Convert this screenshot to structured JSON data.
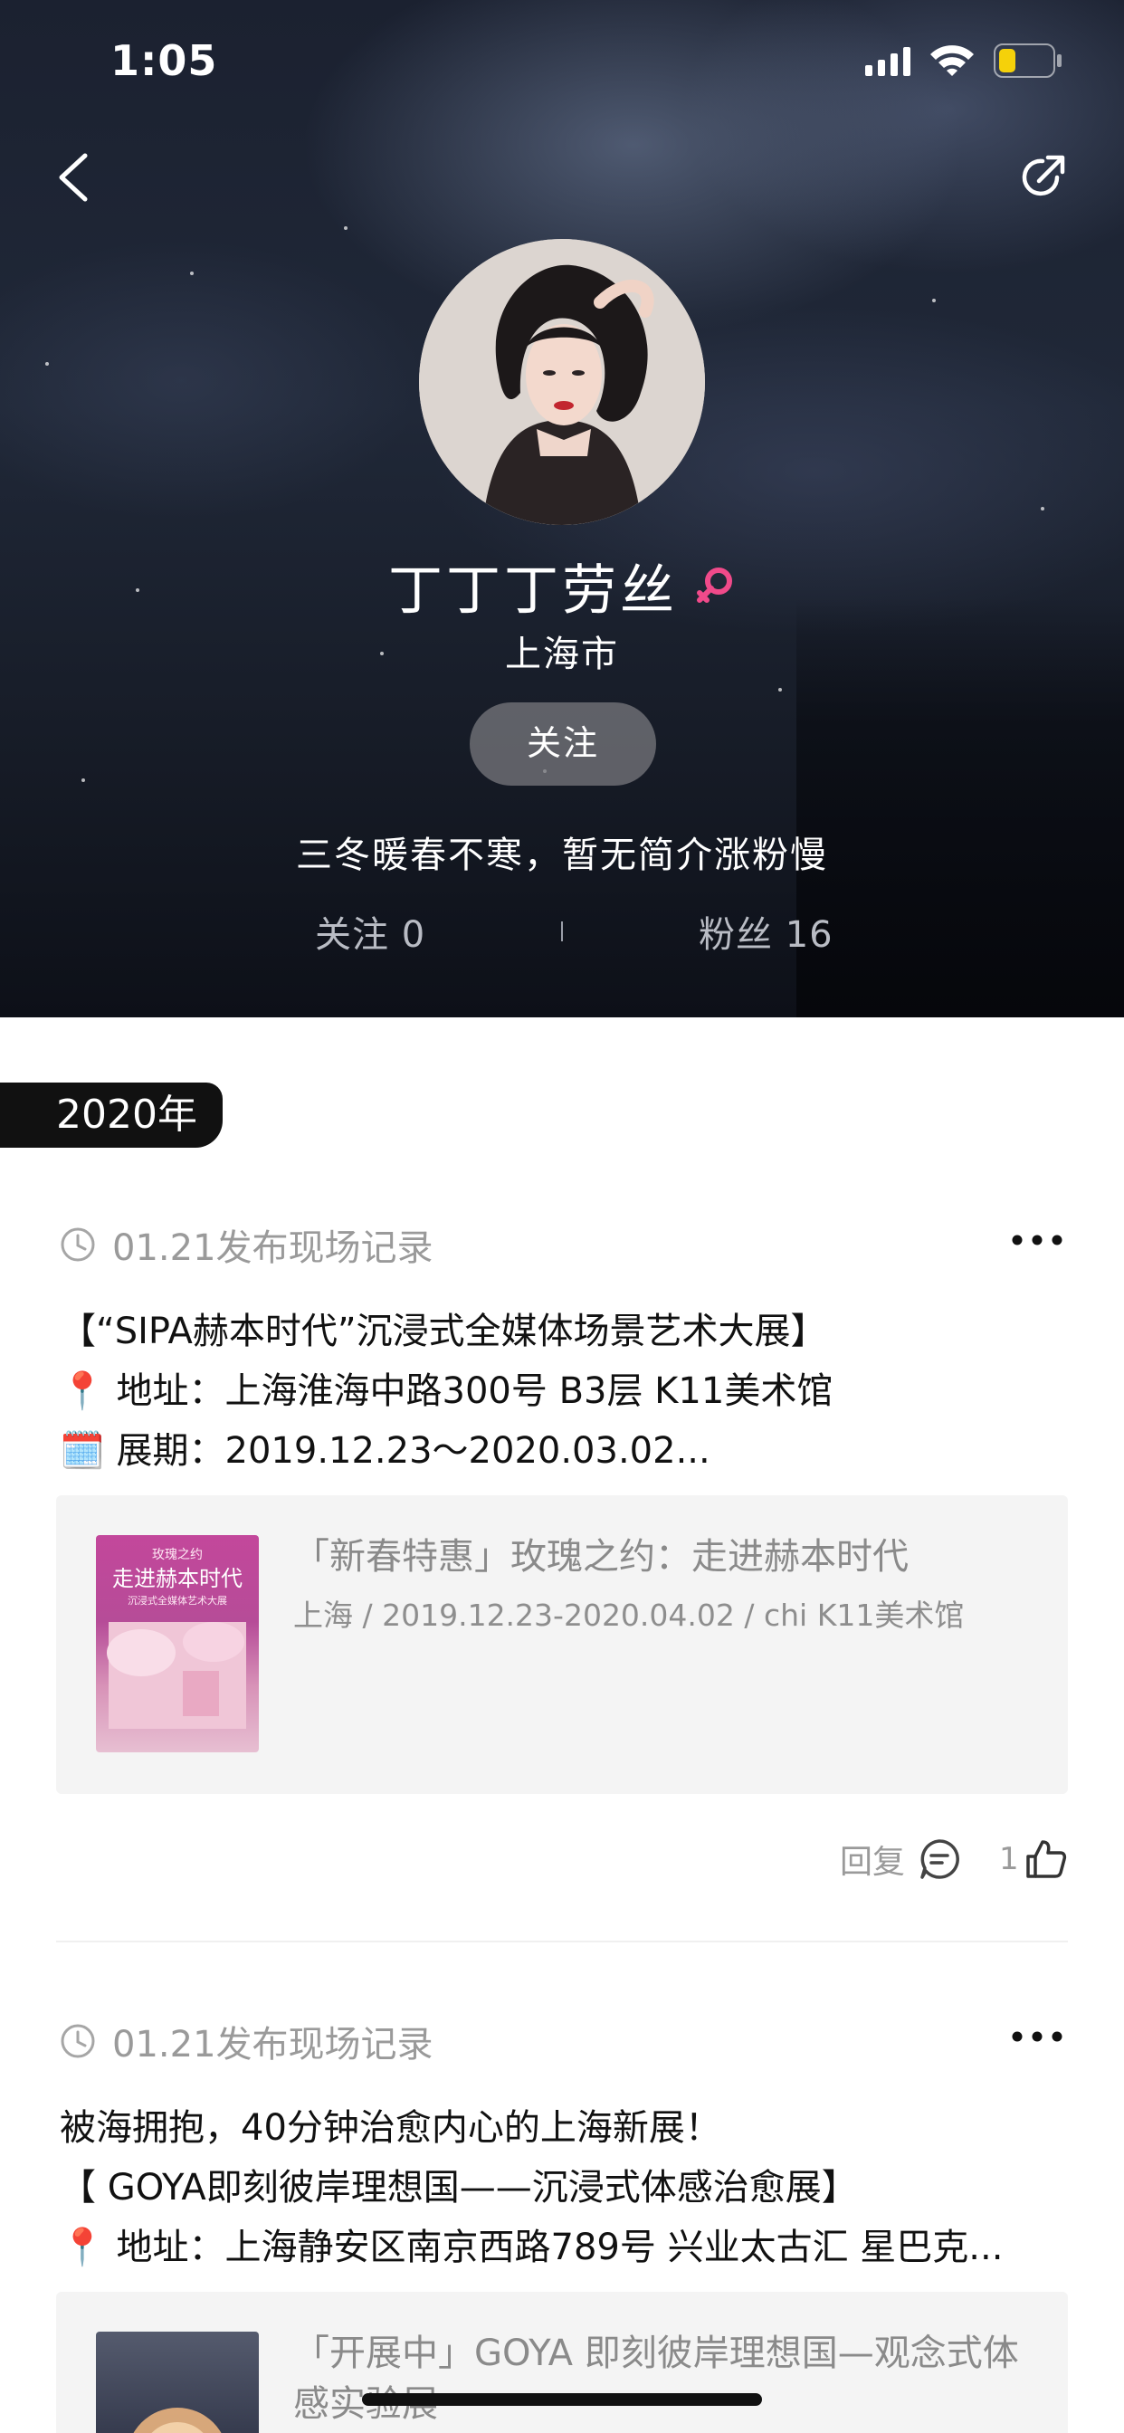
{
  "status_bar": {
    "time": "1:05",
    "icons": [
      "signal-icon",
      "wifi-icon",
      "battery-icon"
    ],
    "battery_color": "#f5d10a"
  },
  "nav": {
    "back_icon": "chevron-left-icon",
    "share_icon": "share-icon"
  },
  "profile": {
    "name": "丁丁丁劳丝",
    "gender_icon": "female-icon",
    "gender_color": "#f04a8a",
    "city": "上海市",
    "follow_label": "关注",
    "bio": "三冬暖春不寒，暂无简介涨粉慢",
    "following_text": "关注 0",
    "fans_text": "粉丝 16"
  },
  "timeline": {
    "year": "2020年",
    "posts": [
      {
        "meta": "01.21发布现场记录",
        "lines": [
          "【“SIPA赫本时代”沉浸式全媒体场景艺术大展】",
          "📍 地址：上海淮海中路300号 B3层 K11美术馆",
          "🗓️ 展期：2019.12.23～2020.03.02..."
        ],
        "card": {
          "title": "「新春特惠」玫瑰之约：走进赫本时代",
          "subtitle": "上海 / 2019.12.23-2020.04.02 / chi K11美术馆",
          "thumb_text_top": "玫瑰之约",
          "thumb_text_main": "走进赫本时代",
          "thumb_text_sub": "沉浸式全媒体艺术大展"
        },
        "reply_label": "回复",
        "like_count": "1"
      },
      {
        "meta": "01.21发布现场记录",
        "lines": [
          "被海拥抱，40分钟治愈内心的上海新展！",
          "【 GOYA即刻彼岸理想国——沉浸式体感治愈展】",
          "📍 地址：上海静安区南京西路789号 兴业太古汇 星巴克..."
        ],
        "card": {
          "title": "「开展中」GOYA 即刻彼岸理想国—观念式体感实验展"
        }
      }
    ]
  }
}
